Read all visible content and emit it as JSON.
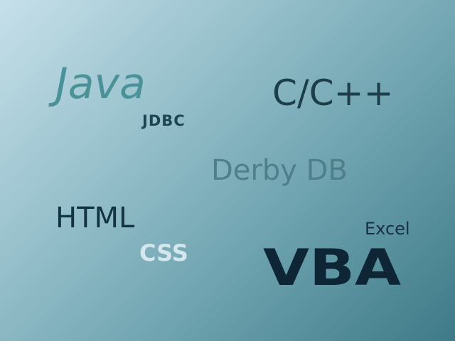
{
  "words": {
    "java": {
      "text": "Java",
      "color": "#4a9298"
    },
    "jdbc": {
      "text": "JDBC",
      "color": "#1d4452"
    },
    "cpp": {
      "text": "C/C++",
      "color": "#1c3e4a"
    },
    "derby": {
      "text": "Derby DB",
      "color": "#4e7f8b"
    },
    "html": {
      "text": "HTML",
      "color": "#123440"
    },
    "excel": {
      "text": "Excel",
      "color": "#16304a"
    },
    "css": {
      "text": "CSS",
      "color": "#d4e7ee"
    },
    "vba": {
      "text": "VBA",
      "color": "#0d2534"
    }
  },
  "background": {
    "gradient_start": "#c6e0ea",
    "gradient_end": "#3f7a88"
  }
}
